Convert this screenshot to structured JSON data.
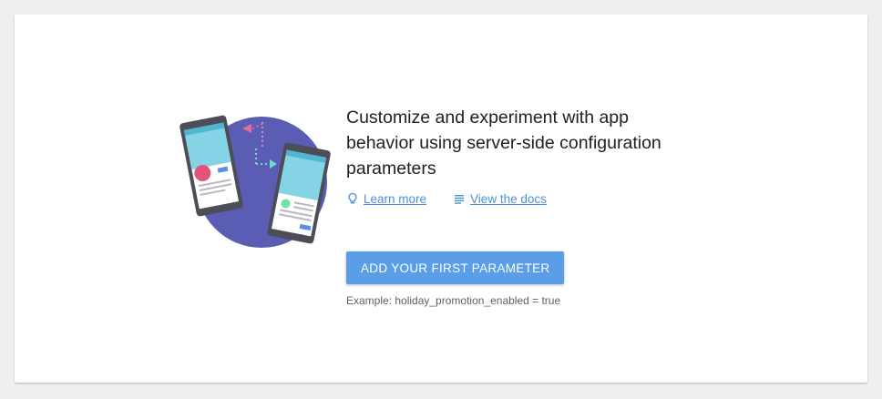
{
  "empty_state": {
    "headline_line1": "Customize and experiment with app",
    "headline_line2": "behavior using server-side configuration",
    "headline_line3": "parameters",
    "learn_more_label": "Learn more",
    "view_docs_label": "View the docs",
    "primary_button_label": "ADD YOUR FIRST PARAMETER",
    "example_text": "Example: holiday_promotion_enabled = true"
  },
  "icons": {
    "learn_more": "lightbulb-icon",
    "view_docs": "docs-list-icon"
  },
  "colors": {
    "link": "#4a90d9",
    "primary_button": "#5b9ee8",
    "illustration_circle": "#5c5fb5",
    "accent_pink": "#e2547a",
    "accent_green": "#6fe3a6"
  }
}
